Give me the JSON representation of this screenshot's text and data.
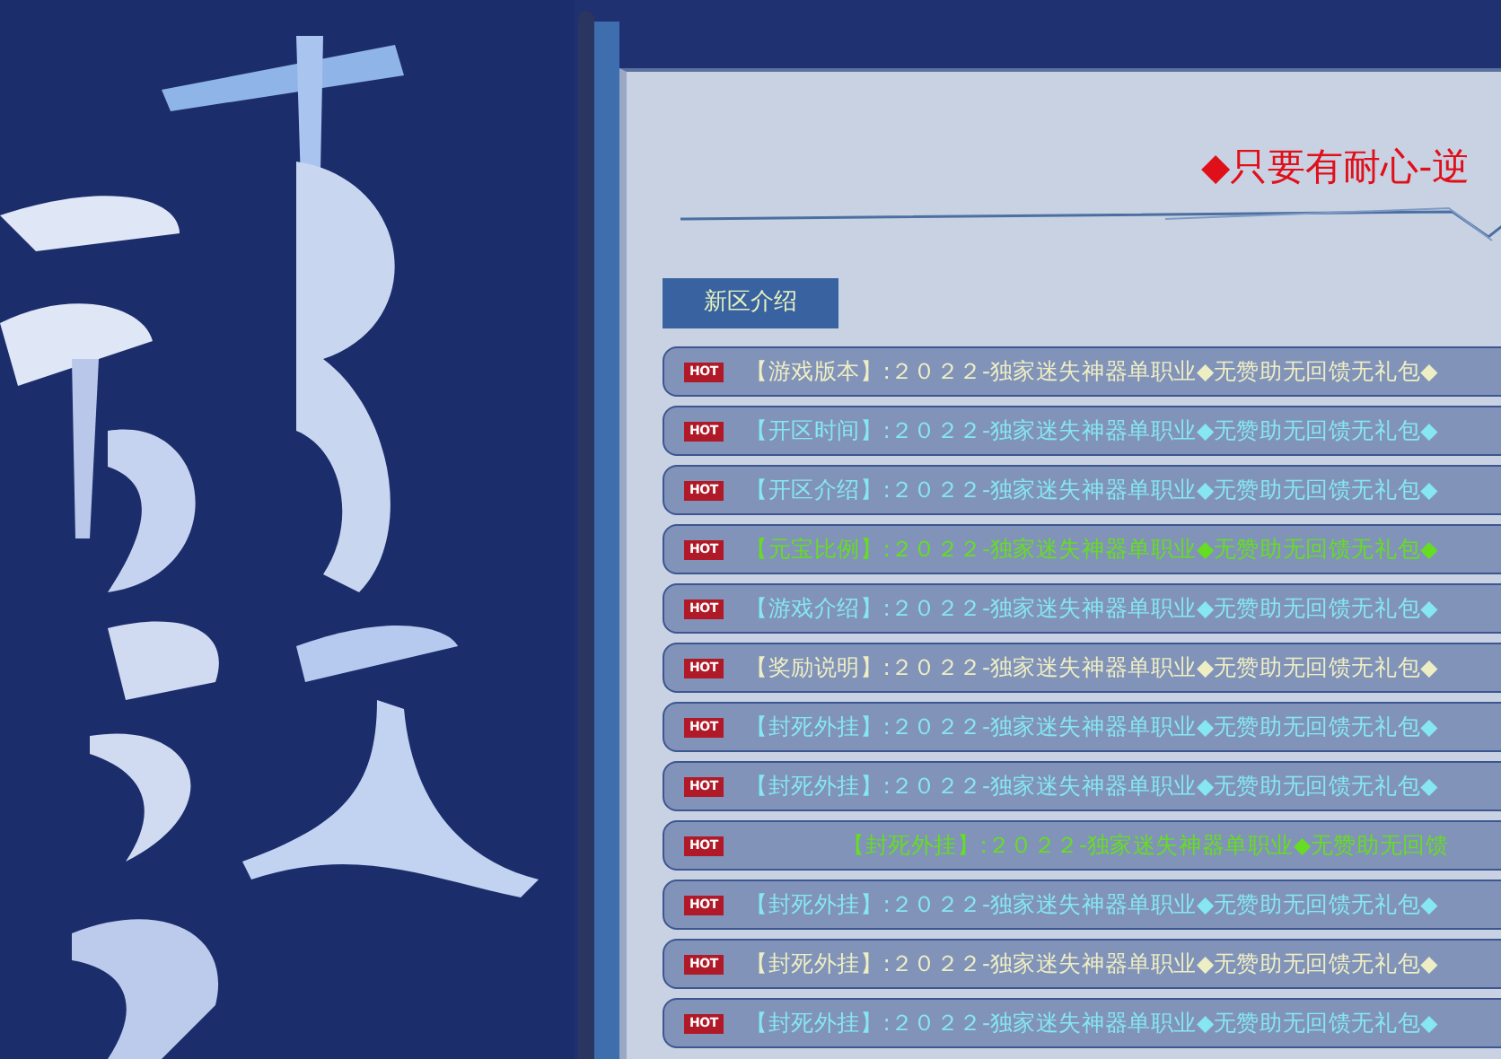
{
  "heading": "◆只要有耐心-逆",
  "tab": "新区介绍",
  "rows": [
    {
      "badge": "HOT",
      "text": "【游戏版本】:２０２２-独家迷失神器单职业◆无赞助无回馈无礼包◆",
      "color": "#eeeec4",
      "kind": "static"
    },
    {
      "badge": "HOT",
      "text": "【开区时间】:２０２２-独家迷失神器单职业◆无赞助无回馈无礼包◆",
      "color": "#86e6f2",
      "kind": "static"
    },
    {
      "badge": "HOT",
      "text": "【开区介绍】:２０２２-独家迷失神器单职业◆无赞助无回馈无礼包◆",
      "color": "#86e6f2",
      "kind": "static"
    },
    {
      "badge": "HOT",
      "text": "【元宝比例】:２０２２-独家迷失神器单职业◆无赞助无回馈无礼包◆",
      "color": "#66dd22",
      "kind": "static"
    },
    {
      "badge": "HOT",
      "text": "【游戏介绍】:２０２２-独家迷失神器单职业◆无赞助无回馈无礼包◆",
      "color": "#86e6f2",
      "kind": "static"
    },
    {
      "badge": "HOT",
      "text": "【奖励说明】:２０２２-独家迷失神器单职业◆无赞助无回馈无礼包◆",
      "color": "#eeeec4",
      "kind": "static"
    },
    {
      "badge": "HOT",
      "text": "【封死外挂】:２０２２-独家迷失神器单职业◆无赞助无回馈无礼包◆",
      "color": "#86e6f2",
      "kind": "static"
    },
    {
      "badge": "HOT",
      "text": "【封死外挂】:２０２２-独家迷失神器单职业◆无赞助无回馈无礼包◆",
      "color": "#86e6f2",
      "kind": "static"
    },
    {
      "badge": "HOT",
      "text": "【封死外挂】:２０２２-独家迷失神器单职业◆无赞助无回馈",
      "color": "#66dd22",
      "kind": "scrolling"
    },
    {
      "badge": "HOT",
      "text": "【封死外挂】:２０２２-独家迷失神器单职业◆无赞助无回馈无礼包◆",
      "color": "#86e6f2",
      "kind": "static"
    },
    {
      "badge": "HOT",
      "text": "【封死外挂】:２０２２-独家迷失神器单职业◆无赞助无回馈无礼包◆",
      "color": "#eeeec4",
      "kind": "static"
    },
    {
      "badge": "HOT",
      "text": "【封死外挂】:２０２２-独家迷失神器单职业◆无赞助无回馈无礼包◆",
      "color": "#86e6f2",
      "kind": "static"
    }
  ]
}
